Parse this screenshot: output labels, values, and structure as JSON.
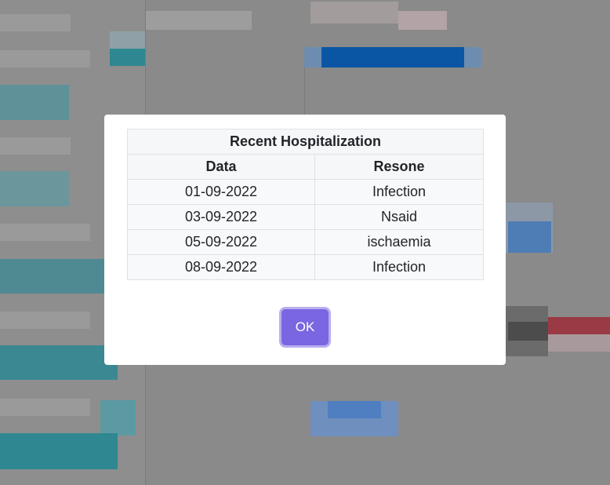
{
  "modal": {
    "title": "Recent Hospitalization",
    "columns": [
      "Data",
      "Resone"
    ],
    "rows": [
      [
        "01-09-2022",
        "Infection"
      ],
      [
        "03-09-2022",
        "Nsaid"
      ],
      [
        "05-09-2022",
        "ischaemia"
      ],
      [
        "08-09-2022",
        "Infection"
      ]
    ],
    "ok_label": "OK",
    "ok_color": "#7a66e0"
  }
}
